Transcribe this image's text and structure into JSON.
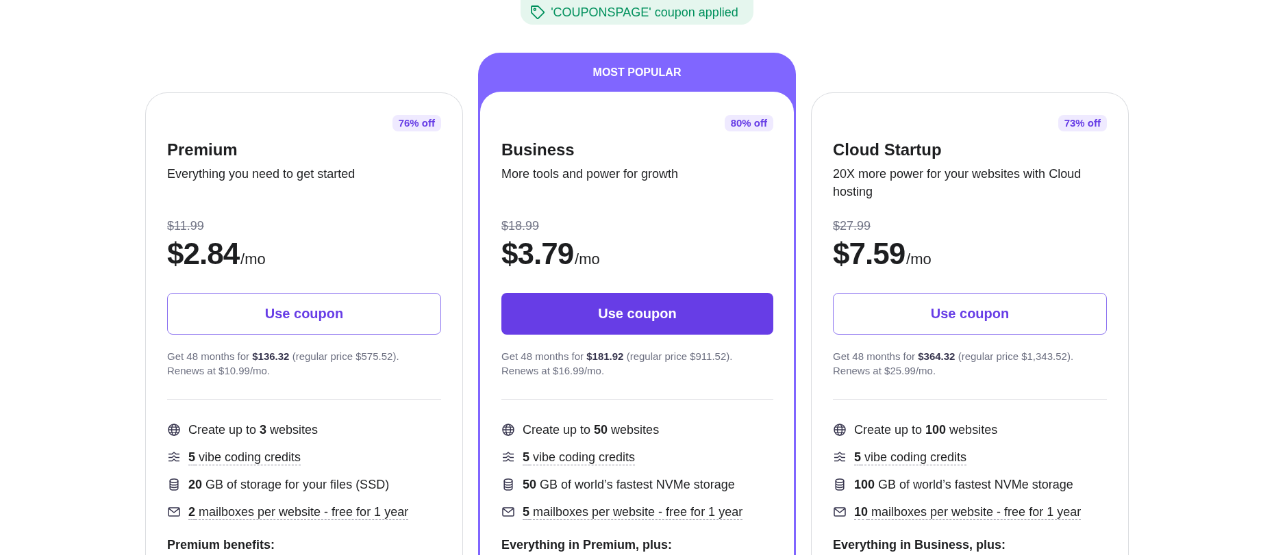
{
  "coupon_banner": {
    "text": "'COUPONSPAGE' coupon applied"
  },
  "plans": [
    {
      "name": "Premium",
      "highlighted": false,
      "discount": "76% off",
      "description": "Everything you need to get started",
      "old_price": "$11.99",
      "price": "$2.84",
      "period": "/mo",
      "button": "Use coupon",
      "billing": "Get 48 months for **$136.32** (regular price $575.52).",
      "renewal": "Renews at $10.99/mo.",
      "features": [
        {
          "kind": "websites",
          "text": "Create up to **3** websites",
          "underlined": false
        },
        {
          "kind": "credits",
          "text": "**5** vibe coding credits",
          "underlined": true
        },
        {
          "kind": "storage",
          "text": "**20** GB of storage for your files (SSD)",
          "underlined": false
        },
        {
          "kind": "email",
          "text": "**2** mailboxes per website - free for 1 year",
          "underlined": true
        }
      ],
      "benefits_heading": "Premium benefits:"
    },
    {
      "ribbon": "MOST POPULAR",
      "name": "Business",
      "highlighted": true,
      "discount": "80% off",
      "description": "More tools and power for growth",
      "old_price": "$18.99",
      "price": "$3.79",
      "period": "/mo",
      "button": "Use coupon",
      "billing": "Get 48 months for **$181.92** (regular price $911.52).",
      "renewal": "Renews at $16.99/mo.",
      "features": [
        {
          "kind": "websites",
          "text": "Create up to **50** websites",
          "underlined": false
        },
        {
          "kind": "credits",
          "text": "**5** vibe coding credits",
          "underlined": true
        },
        {
          "kind": "storage",
          "text": "**50** GB of world’s fastest NVMe storage",
          "underlined": false
        },
        {
          "kind": "email",
          "text": "**5** mailboxes per website - free for 1 year",
          "underlined": true
        }
      ],
      "benefits_heading": "Everything in Premium, plus:"
    },
    {
      "name": "Cloud Startup",
      "highlighted": false,
      "discount": "73% off",
      "description": "20X more power for your websites with Cloud hosting",
      "old_price": "$27.99",
      "price": "$7.59",
      "period": "/mo",
      "button": "Use coupon",
      "billing": "Get 48 months for **$364.32** (regular price $1,343.52).",
      "renewal": "Renews at $25.99/mo.",
      "features": [
        {
          "kind": "websites",
          "text": "Create up to **100** websites",
          "underlined": false
        },
        {
          "kind": "credits",
          "text": "**5** vibe coding credits",
          "underlined": true
        },
        {
          "kind": "storage",
          "text": "**100** GB of world’s fastest NVMe storage",
          "underlined": false
        },
        {
          "kind": "email",
          "text": "**10** mailboxes per website - free for 1 year",
          "underlined": true
        }
      ],
      "benefits_heading": "Everything in Business, plus:"
    }
  ]
}
